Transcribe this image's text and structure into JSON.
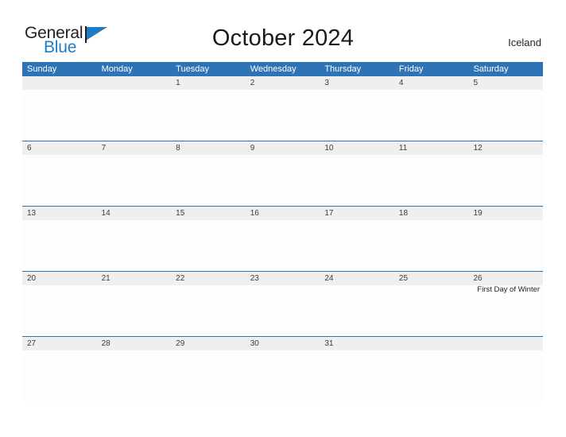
{
  "brand": {
    "name_part1": "General",
    "name_part2": "Blue",
    "flag_icon": "blue-triangle-flag-icon",
    "color_dark": "#231f20",
    "color_blue": "#1f7bc4"
  },
  "header": {
    "title": "October 2024",
    "location": "Iceland"
  },
  "theme": {
    "header_blue": "#2d73b5",
    "date_band_gray": "#efefef",
    "cell_white": "#fdfdfd",
    "text_dark": "#3c3c3c"
  },
  "calendar": {
    "weekdays": [
      "Sunday",
      "Monday",
      "Tuesday",
      "Wednesday",
      "Thursday",
      "Friday",
      "Saturday"
    ],
    "weeks": [
      [
        {
          "day": "",
          "events": []
        },
        {
          "day": "",
          "events": []
        },
        {
          "day": "1",
          "events": []
        },
        {
          "day": "2",
          "events": []
        },
        {
          "day": "3",
          "events": []
        },
        {
          "day": "4",
          "events": []
        },
        {
          "day": "5",
          "events": []
        }
      ],
      [
        {
          "day": "6",
          "events": []
        },
        {
          "day": "7",
          "events": []
        },
        {
          "day": "8",
          "events": []
        },
        {
          "day": "9",
          "events": []
        },
        {
          "day": "10",
          "events": []
        },
        {
          "day": "11",
          "events": []
        },
        {
          "day": "12",
          "events": []
        }
      ],
      [
        {
          "day": "13",
          "events": []
        },
        {
          "day": "14",
          "events": []
        },
        {
          "day": "15",
          "events": []
        },
        {
          "day": "16",
          "events": []
        },
        {
          "day": "17",
          "events": []
        },
        {
          "day": "18",
          "events": []
        },
        {
          "day": "19",
          "events": []
        }
      ],
      [
        {
          "day": "20",
          "events": []
        },
        {
          "day": "21",
          "events": []
        },
        {
          "day": "22",
          "events": []
        },
        {
          "day": "23",
          "events": []
        },
        {
          "day": "24",
          "events": []
        },
        {
          "day": "25",
          "events": []
        },
        {
          "day": "26",
          "events": [
            "First Day of Winter"
          ]
        }
      ],
      [
        {
          "day": "27",
          "events": []
        },
        {
          "day": "28",
          "events": []
        },
        {
          "day": "29",
          "events": []
        },
        {
          "day": "30",
          "events": []
        },
        {
          "day": "31",
          "events": []
        },
        {
          "day": "",
          "events": []
        },
        {
          "day": "",
          "events": []
        }
      ]
    ]
  }
}
